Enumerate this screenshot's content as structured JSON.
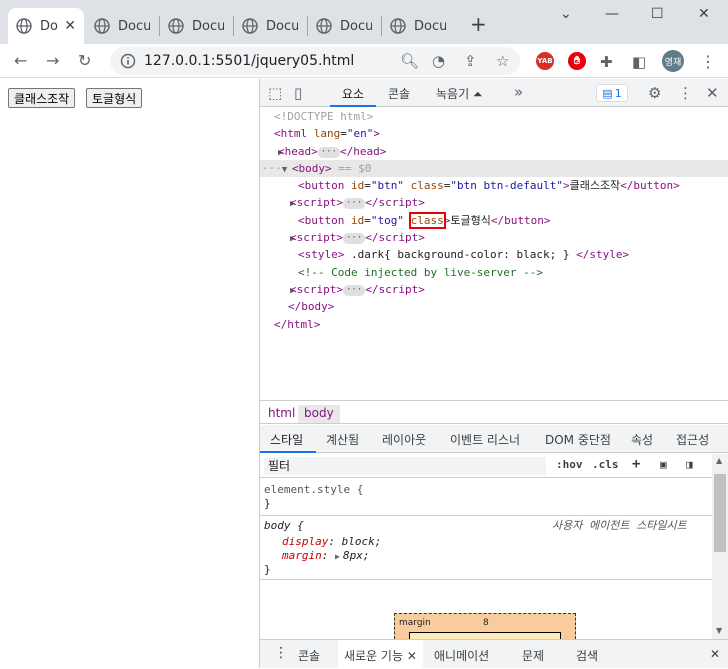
{
  "browser": {
    "tabs": [
      {
        "title": "Do"
      },
      {
        "title": "Docu"
      },
      {
        "title": "Docu"
      },
      {
        "title": "Docu"
      },
      {
        "title": "Docu"
      },
      {
        "title": "Docu"
      }
    ],
    "url": "127.0.0.1:5501/jquery05.html",
    "extension_label": "YAB",
    "profile_initials": "영재"
  },
  "page": {
    "buttons": [
      {
        "label": "클래스조작"
      },
      {
        "label": "토글형식"
      }
    ]
  },
  "devtools": {
    "tabs": [
      "요소",
      "콘솔",
      "녹음기 ⏶"
    ],
    "issues_count": "1",
    "dom_lines": {
      "doctype": "<!DOCTYPE html>",
      "html_open_tag": "<html",
      "html_attr": "lang",
      "html_attr_val": "\"en\"",
      "head_open": "<head>",
      "head_close": "</head>",
      "body_open": "<body>",
      "body_eq": "== $0",
      "btn1_id_val": "\"btn\"",
      "btn1_class_val": "\"btn btn-default\"",
      "btn1_text": "클래스조작",
      "btn2_id_val": "\"tog\"",
      "btn2_class": "class",
      "btn2_text": "토글형식",
      "style_text": ".dark{ background-color: black; }",
      "comment": "<!-- Code injected by live-server -->",
      "body_close": "</body>",
      "html_close": "</html>"
    },
    "breadcrumbs": [
      "html",
      "body"
    ],
    "styles_tabs": [
      "스타일",
      "계산됨",
      "레이아웃",
      "이벤트 리스너",
      "DOM 중단점",
      "속성",
      "접근성"
    ],
    "filter_placeholder": "필터",
    "filter_tools": {
      "hov": ":hov",
      "cls": ".cls"
    },
    "rules": {
      "element_style": "element.style {",
      "close_brace": "}",
      "body_selector": "body {",
      "ua_label": "사용자 에이전트 스타일시트",
      "decl1_prop": "display",
      "decl1_val": "block;",
      "decl2_prop": "margin",
      "decl2_val": "8px;"
    },
    "box_model": {
      "label": "margin",
      "value": "8"
    },
    "drawer_tabs": [
      "콘솔",
      "새로운 기능",
      "애니메이션",
      "문제",
      "검색"
    ]
  }
}
